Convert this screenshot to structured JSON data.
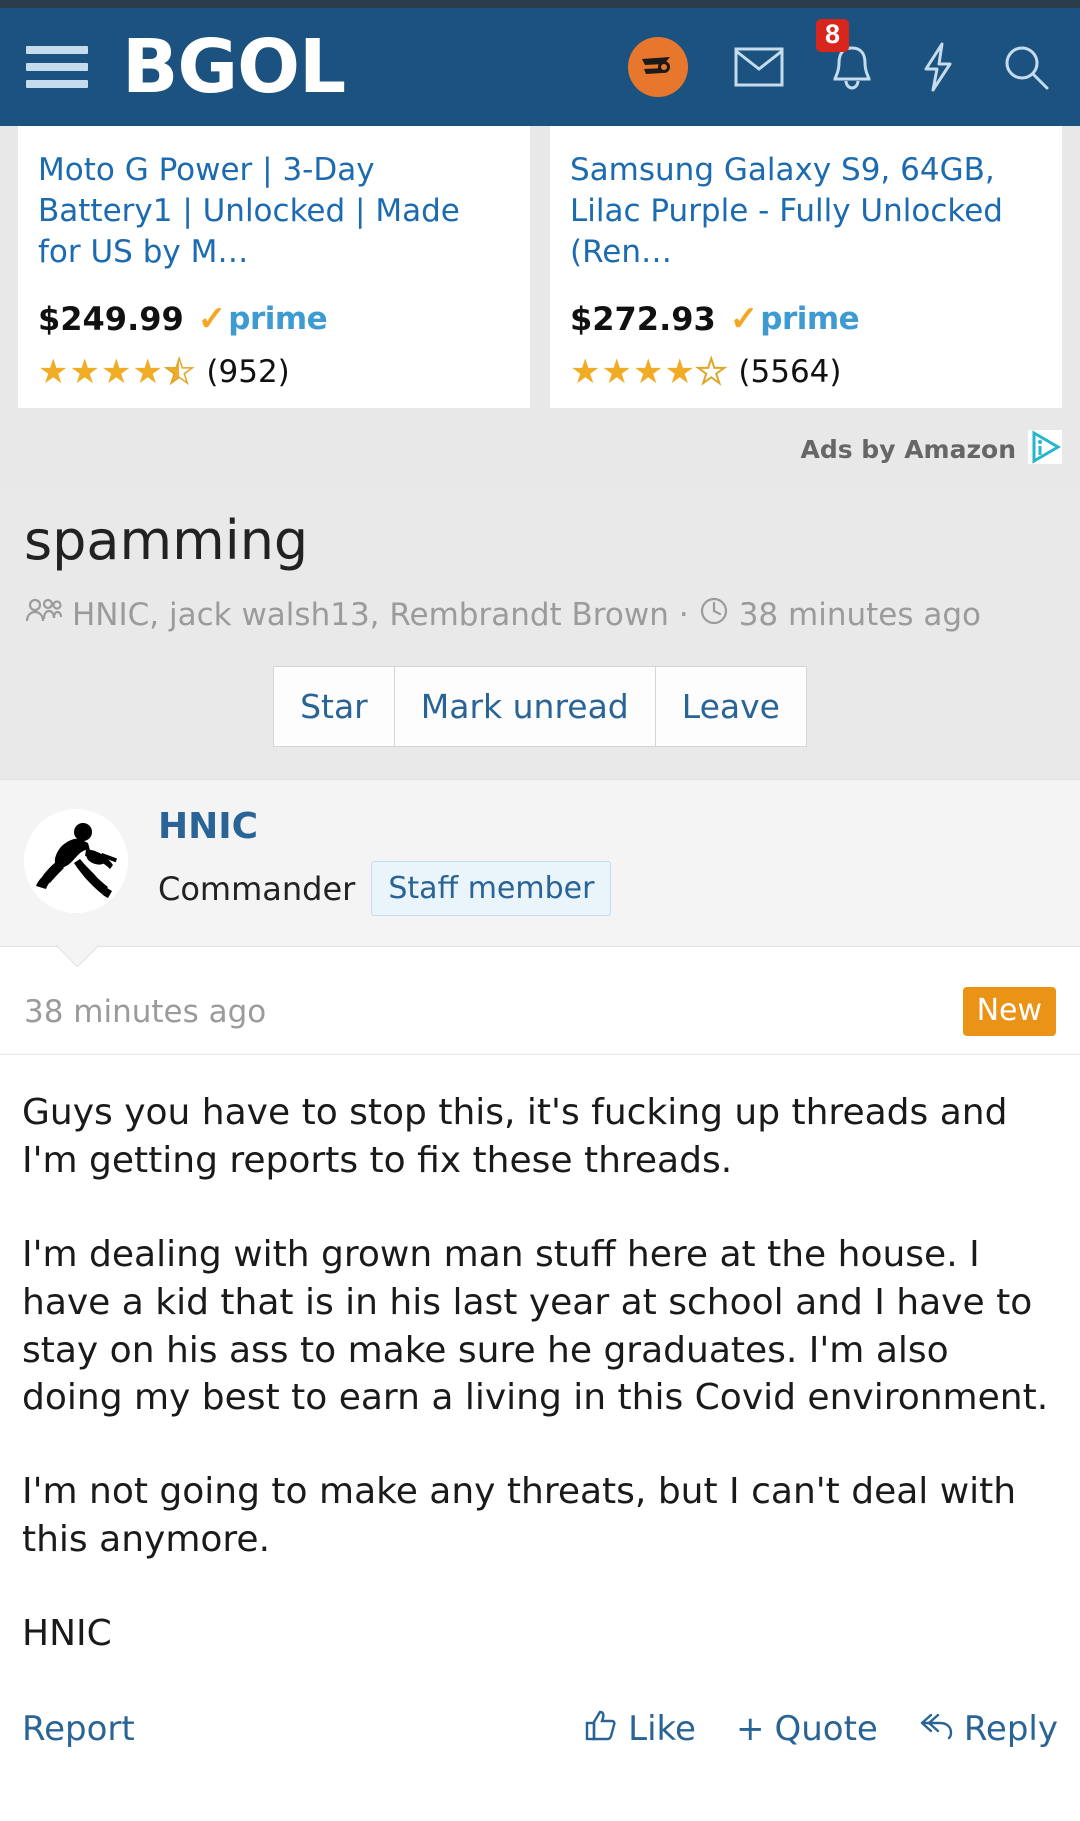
{
  "header": {
    "logo": "BGOL",
    "menu_icon": "hamburger-menu-icon",
    "avatar_icon": "flyers-avatar-icon",
    "mail_icon": "envelope-icon",
    "bell_icon": "bell-icon",
    "bell_badge": "8",
    "bolt_icon": "lightning-bolt-icon",
    "search_icon": "search-icon"
  },
  "ads": {
    "items": [
      {
        "title": "Moto G Power | 3-Day Battery1 | Unlocked | Made for US by M…",
        "price": "$249.99",
        "prime_label": "prime",
        "rating": 4.5,
        "review_count": "(952)"
      },
      {
        "title": "Samsung Galaxy S9, 64GB, Lilac Purple - Fully Unlocked (Ren…",
        "price": "$272.93",
        "prime_label": "prime",
        "rating": 4,
        "review_count": "(5564)"
      }
    ],
    "attribution": "Ads by Amazon",
    "adchoices_icon": "adchoices-icon"
  },
  "thread": {
    "title": "spamming",
    "participants": "HNIC, jack walsh13, Rembrandt Brown",
    "separator": "·",
    "time": "38 minutes ago",
    "people_icon": "people-icon",
    "clock_icon": "clock-icon",
    "actions": [
      "Star",
      "Mark unread",
      "Leave"
    ]
  },
  "post": {
    "username": "HNIC",
    "user_title": "Commander",
    "staff_badge": "Staff member",
    "avatar_icon": "running-guitarist-silhouette-icon",
    "time": "38 minutes ago",
    "new_badge": "New",
    "paragraphs": [
      "Guys you have to stop this, it's fucking up threads and I'm getting reports to fix these threads.",
      "I'm dealing with grown man stuff here at the house. I have a kid that is in his last year at school and I have to stay on his ass to make sure he graduates. I'm also doing my best to earn a living in this Covid environment.",
      "I'm not going to make any threats, but I can't deal with this anymore."
    ],
    "signature": "HNIC",
    "footer": {
      "report": "Report",
      "like": "Like",
      "quote": "Quote",
      "quote_plus": "+",
      "reply": "Reply",
      "like_icon": "thumbs-up-icon",
      "reply_icon": "reply-arrow-icon"
    }
  },
  "colors": {
    "header_bg": "#1c5280",
    "link": "#2a6496",
    "new_badge": "#eb9316",
    "badge_red": "#d9261c",
    "star": "#f0ac25"
  }
}
